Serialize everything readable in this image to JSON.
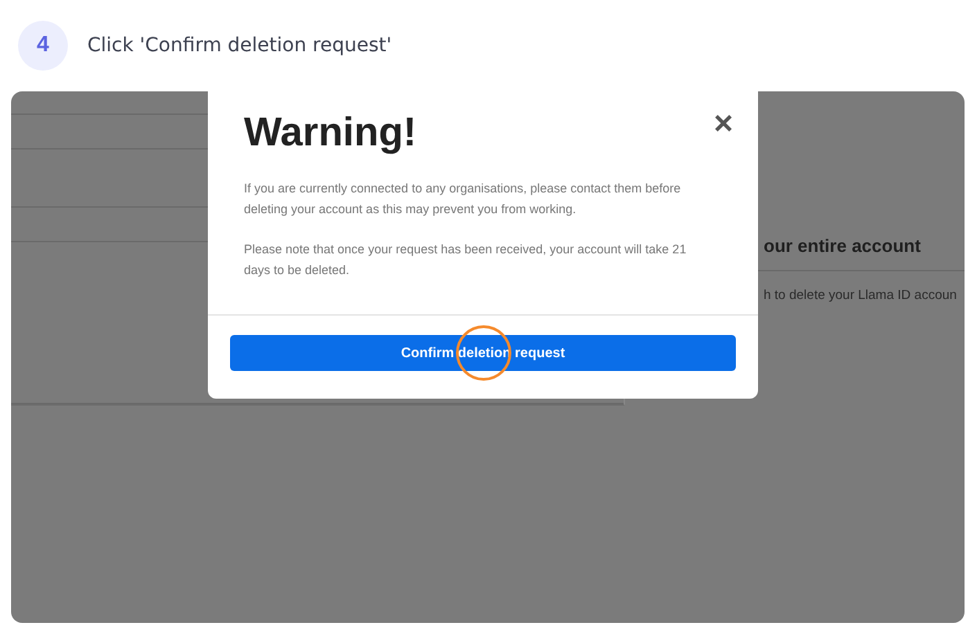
{
  "step": {
    "number": "4",
    "instruction": "Click 'Confirm deletion request'"
  },
  "background_page": {
    "heading": "our entire account",
    "description": "h to delete your Llama ID accoun"
  },
  "modal": {
    "close": "×",
    "title": "Warning!",
    "paragraphs": [
      "If you are currently connected to any organisations, please contact them before deleting your account as this may prevent you from working.",
      "Please note that once your request has been received, your account will take 21 days to be deleted."
    ],
    "button": "Confirm deletion request"
  }
}
